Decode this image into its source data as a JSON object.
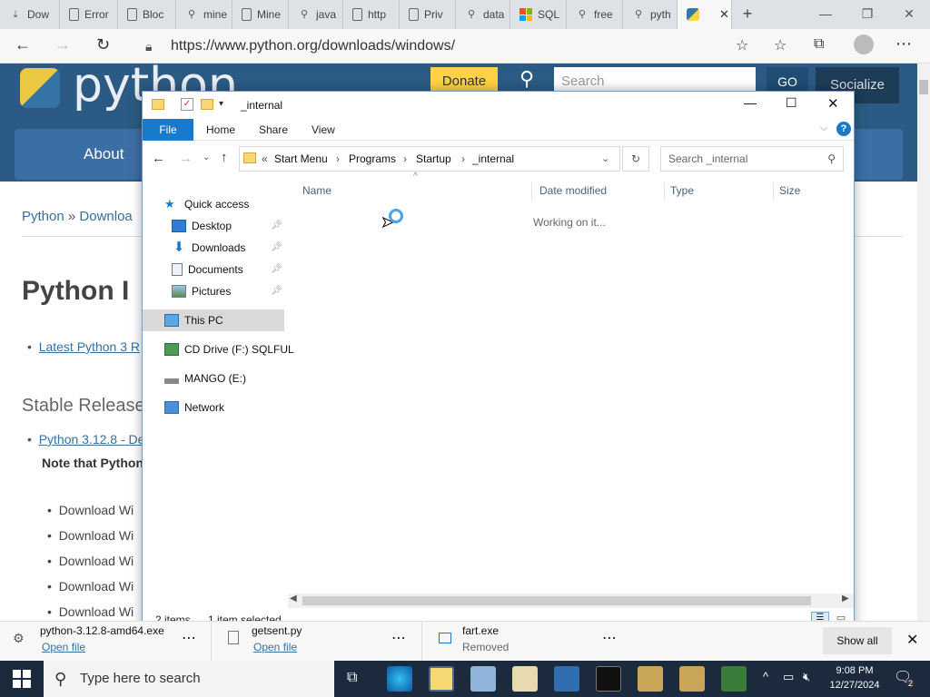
{
  "browser": {
    "tabs": [
      {
        "label": "Dow",
        "icon": "download-icon"
      },
      {
        "label": "Error",
        "icon": "page-icon"
      },
      {
        "label": "Bloc",
        "icon": "page-icon"
      },
      {
        "label": "mine",
        "icon": "search-icon"
      },
      {
        "label": "Mine",
        "icon": "page-icon"
      },
      {
        "label": "java",
        "icon": "search-icon"
      },
      {
        "label": "http",
        "icon": "page-icon"
      },
      {
        "label": "Priv",
        "icon": "page-icon"
      },
      {
        "label": "data",
        "icon": "search-icon"
      },
      {
        "label": "SQL",
        "icon": "microsoft-icon"
      },
      {
        "label": "free",
        "icon": "search-icon"
      },
      {
        "label": "pyth",
        "icon": "search-icon"
      },
      {
        "label": "",
        "icon": "python-icon",
        "active": true
      }
    ],
    "url": "https://www.python.org/downloads/windows/"
  },
  "site": {
    "logo": "python",
    "donate": "Donate",
    "search_placeholder": "Search",
    "go": "GO",
    "socialize": "Socialize",
    "about": "About",
    "breadcrumb_python": "Python",
    "breadcrumb_sep": "»",
    "breadcrumb_downloads": "Downloa",
    "heading": "Python I",
    "latest_link": "Latest Python 3 R",
    "stable_heading": "Stable Release",
    "release_link": "Python 3.12.8 - De",
    "note": "Note that Python",
    "download_items": [
      "Download Wi",
      "Download Wi",
      "Download Wi",
      "Download Wi",
      "Download Wi"
    ]
  },
  "explorer": {
    "title": "_internal",
    "ribbon_tabs": [
      "File",
      "Home",
      "Share",
      "View"
    ],
    "breadcrumb": [
      "Start Menu",
      "Programs",
      "Startup",
      "_internal"
    ],
    "breadcrumb_prefix": "«",
    "search_placeholder": "Search _internal",
    "nav": [
      {
        "label": "Quick access",
        "icon": "star-icon",
        "indent": 1
      },
      {
        "label": "Desktop",
        "icon": "desktop-icon",
        "indent": 2,
        "pinned": true
      },
      {
        "label": "Downloads",
        "icon": "download-arrow-icon",
        "indent": 2,
        "pinned": true
      },
      {
        "label": "Documents",
        "icon": "documents-icon",
        "indent": 2,
        "pinned": true
      },
      {
        "label": "Pictures",
        "icon": "pictures-icon",
        "indent": 2,
        "pinned": true
      },
      {
        "label": "This PC",
        "icon": "computer-icon",
        "indent": 1,
        "selected": true
      },
      {
        "label": "CD Drive (F:) SQLFUL",
        "icon": "cd-drive-icon",
        "indent": 1
      },
      {
        "label": "MANGO (E:)",
        "icon": "usb-drive-icon",
        "indent": 1
      },
      {
        "label": "Network",
        "icon": "network-icon",
        "indent": 1
      }
    ],
    "columns": [
      "Name",
      "Date modified",
      "Type",
      "Size"
    ],
    "working_text": "Working on it...",
    "status_items": "2 items",
    "status_selected": "1 item selected"
  },
  "downloads": [
    {
      "name": "python-3.12.8-amd64.exe",
      "action": "Open file"
    },
    {
      "name": "getsent.py",
      "action": "Open file"
    },
    {
      "name": "fart.exe",
      "action": "Removed"
    }
  ],
  "downloads_show_all": "Show all",
  "taskbar": {
    "search_placeholder": "Type here to search",
    "time": "9:08 PM",
    "date": "12/27/2024",
    "notifications": "2"
  },
  "colors": {
    "python_blue": "#2b5b84",
    "file_tab": "#1979ca",
    "taskbar": "#1b2a3c"
  }
}
